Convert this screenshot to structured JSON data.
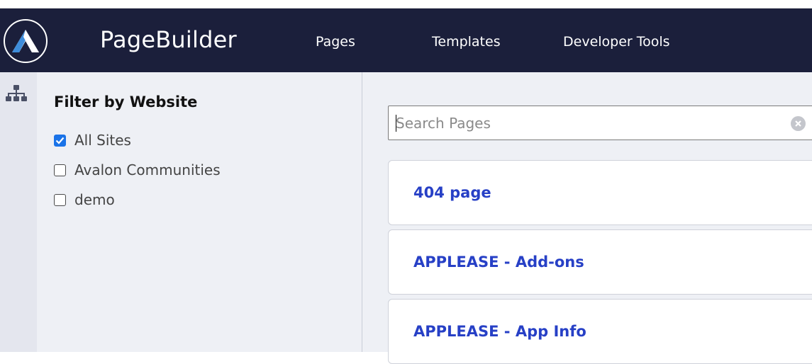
{
  "app": {
    "brand": "PageBuilder",
    "logo_icon": "app-logo-icon"
  },
  "nav": {
    "pages": "Pages",
    "templates": "Templates",
    "developer_tools": "Developer Tools"
  },
  "rail": {
    "icon": "sitemap-icon"
  },
  "filter": {
    "title": "Filter by Website",
    "options": [
      {
        "label": "All Sites",
        "checked": true
      },
      {
        "label": "Avalon Communities",
        "checked": false
      },
      {
        "label": "demo",
        "checked": false
      }
    ]
  },
  "search": {
    "placeholder": "Search Pages",
    "value": ""
  },
  "pages": [
    {
      "title": "404 page"
    },
    {
      "title": "APPLEASE - Add-ons"
    },
    {
      "title": "APPLEASE - App Info"
    }
  ],
  "colors": {
    "navbar": "#1b1f3b",
    "accent": "#2740c6",
    "checkbox": "#1a73e8"
  }
}
